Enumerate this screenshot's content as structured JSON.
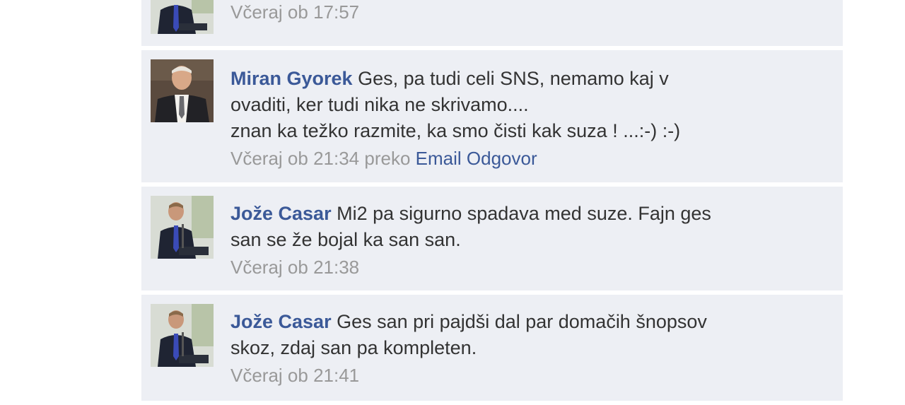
{
  "comments": [
    {
      "author": "",
      "text": "",
      "time": "Včeraj ob 17:57",
      "via": "",
      "email": "",
      "reply": "",
      "avatar": "man-at-lectern-avatar"
    },
    {
      "author": "Miran Gyorek",
      "text": "Ges, pa tudi celi SNS, nemamo kaj v\novaditi, ker tudi nika ne skrivamo....\nznan ka težko razmite, ka smo čisti kak suza ! ...:-) :-)",
      "time": "Včeraj ob 21:34",
      "via": "preko",
      "email": "Email",
      "reply": "Odgovor",
      "avatar": "man-in-suit-avatar"
    },
    {
      "author": "Jože Casar",
      "text": "Mi2 pa sigurno spadava med suze. Fajn ges\nsan se že bojal ka san san.",
      "time": "Včeraj ob 21:38",
      "via": "",
      "email": "",
      "reply": "",
      "avatar": "man-at-lectern-avatar"
    },
    {
      "author": "Jože Casar",
      "text": "Ges san pri pajdši dal par domačih šnopsov\nskoz, zdaj san pa kompleten.",
      "time": "Včeraj ob 21:41",
      "via": "",
      "email": "",
      "reply": "",
      "avatar": "man-at-lectern-avatar"
    }
  ],
  "colors": {
    "comment_bg": "#edeff4",
    "link": "#3b5998",
    "text": "#333333",
    "meta": "#999999"
  }
}
